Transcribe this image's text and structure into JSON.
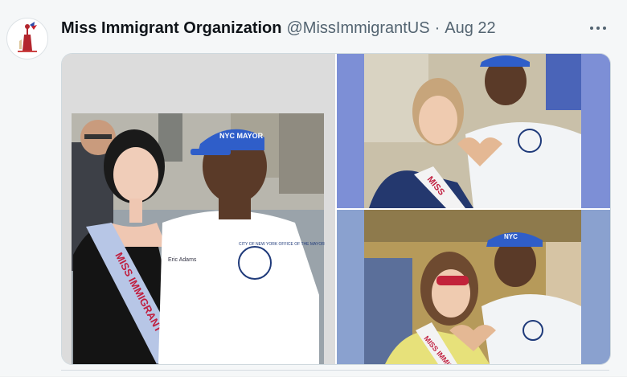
{
  "tweet": {
    "display_name": "Miss Immigrant Organization",
    "handle": "@MissImmigrantUS",
    "separator": "·",
    "date": "Aug 22",
    "more_icon": "more-horizontal-icon"
  },
  "photos": {
    "left": {
      "cap_text": "NYC MAYOR",
      "sash_text": "MISS IMMIGRANT",
      "seal_text": "CITY OF NEW YORK OFFICE OF THE MAYOR",
      "name_tag": "Eric Adams"
    },
    "top_right": {
      "sash_text": "MISS"
    },
    "bottom_right": {
      "sash_text": "MISS IMMIGRANT",
      "cap_text": "NYC"
    }
  }
}
